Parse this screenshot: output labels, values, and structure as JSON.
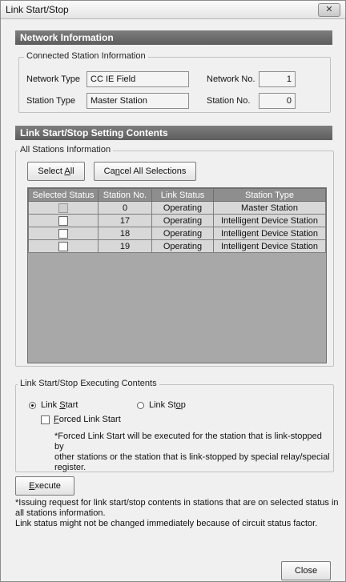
{
  "window": {
    "title": "Link Start/Stop",
    "close_glyph": "✕"
  },
  "network_info": {
    "header": "Network Information",
    "group_label": "Connected Station Information",
    "network_type_label": "Network Type",
    "network_type_value": "CC IE Field",
    "network_no_label": "Network No.",
    "network_no_value": "1",
    "station_type_label": "Station Type",
    "station_type_value": "Master Station",
    "station_no_label": "Station No.",
    "station_no_value": "0"
  },
  "setting": {
    "header": "Link Start/Stop Setting Contents",
    "group_label": "All Stations Information",
    "select_all": "Select All",
    "cancel_all": "Cancel All Selections",
    "columns": [
      "Selected Status",
      "Station No.",
      "Link Status",
      "Station Type"
    ],
    "rows": [
      {
        "selected": false,
        "disabled": true,
        "station_no": "0",
        "link_status": "Operating",
        "station_type": "Master Station"
      },
      {
        "selected": false,
        "disabled": false,
        "station_no": "17",
        "link_status": "Operating",
        "station_type": "Intelligent Device Station"
      },
      {
        "selected": false,
        "disabled": false,
        "station_no": "18",
        "link_status": "Operating",
        "station_type": "Intelligent Device Station"
      },
      {
        "selected": false,
        "disabled": false,
        "station_no": "19",
        "link_status": "Operating",
        "station_type": "Intelligent Device Station"
      }
    ]
  },
  "executing": {
    "group_label": "Link Start/Stop Executing Contents",
    "link_start": "Link Start",
    "link_stop": "Link Stop",
    "selected_option": "Link Start",
    "forced_link_start": "Forced Link Start",
    "forced_checked": false,
    "forced_note": "*Forced Link Start will be executed for the station that is link-stopped by\nother stations or the station that is link-stopped by special relay/special\n register."
  },
  "execute_button": "Execute",
  "footer_note": "*Issuing request for link start/stop contents in stations that are on selected status in\n all stations information.\nLink status might not be changed immediately because of circuit status factor.",
  "close_button": "Close"
}
